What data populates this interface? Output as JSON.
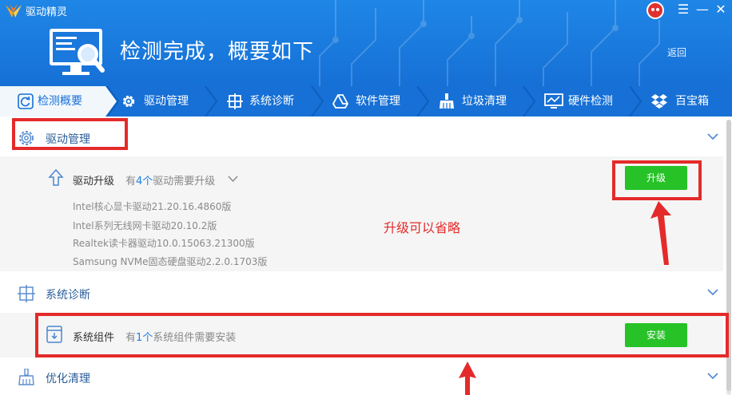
{
  "app": {
    "title": "驱动精灵"
  },
  "header": {
    "page_title": "检测完成，概要如下",
    "back_label": "返回"
  },
  "tabs": [
    {
      "label": "检测概要",
      "icon": "refresh-icon",
      "active": true
    },
    {
      "label": "驱动管理",
      "icon": "gear-icon"
    },
    {
      "label": "系统诊断",
      "icon": "crosshair-icon"
    },
    {
      "label": "软件管理",
      "icon": "triangle-icon"
    },
    {
      "label": "垃圾清理",
      "icon": "broom-icon"
    },
    {
      "label": "硬件检测",
      "icon": "monitor-icon"
    },
    {
      "label": "百宝箱",
      "icon": "dropbox-icon"
    }
  ],
  "sections": {
    "driver": {
      "title": "驱动管理",
      "row": {
        "title": "驱动升级",
        "desc_prefix": "有",
        "count": "4个",
        "desc_suffix": "驱动需要升级",
        "button": "升级",
        "items": [
          "Intel核心显卡驱动21.20.16.4860版",
          "Intel系列无线网卡驱动20.10.2版",
          "Realtek读卡器驱动10.0.15063.21300版",
          "Samsung NVMe固态硬盘驱动2.2.0.1703版"
        ]
      }
    },
    "diagnose": {
      "title": "系统诊断",
      "row": {
        "title": "系统组件",
        "desc_prefix": "有",
        "count": "1个",
        "desc_suffix": "系统组件需要安装",
        "button": "安装"
      }
    },
    "cleanup": {
      "title": "优化清理"
    }
  },
  "annotation": {
    "text": "升级可以省略",
    "color": "#e42a2a"
  },
  "colors": {
    "brand_blue": "#1670d6",
    "button_green": "#26c227"
  }
}
